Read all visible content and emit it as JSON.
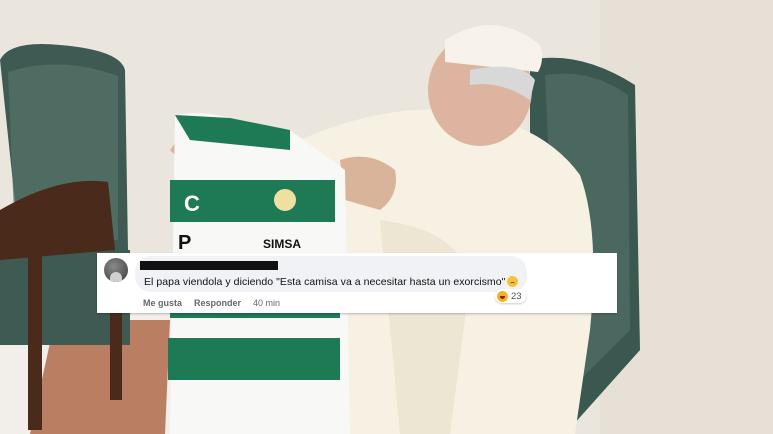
{
  "comment": {
    "text": "El papa viendola y diciendo \"Esta camisa va a necesitar hasta un exorcismo\"",
    "text_emoji": "disappointed-face-icon",
    "reaction_emoji": "haha-icon",
    "reaction_count": "23",
    "like_label": "Me gusta",
    "reply_label": "Responder",
    "time_label": "40 min"
  },
  "photo": {
    "jersey_sponsor": "SIMSA",
    "jersey_brand": "C",
    "jersey_brand_p": "P"
  }
}
